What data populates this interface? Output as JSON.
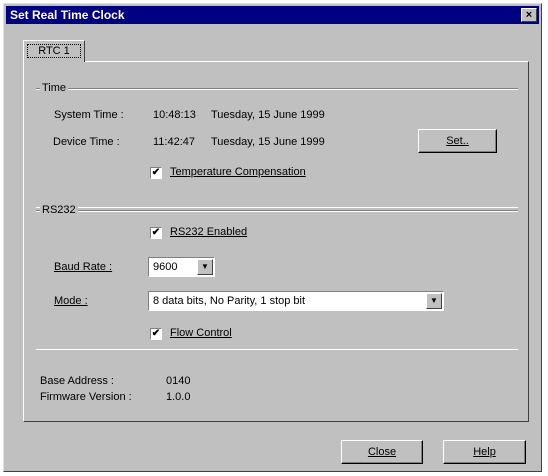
{
  "window": {
    "title": "Set Real Time Clock",
    "close_glyph": "×"
  },
  "tab": {
    "label": "RTC 1"
  },
  "time_group": {
    "legend": "Time",
    "system_time_label": "System Time :",
    "system_time_value": "10:48:13",
    "system_date_value": "Tuesday, 15 June 1999",
    "device_time_label": "Device Time :",
    "device_time_value": "11:42:47",
    "device_date_value": "Tuesday, 15 June 1999",
    "set_button": "Set..",
    "temp_comp": {
      "label": "Temperature Compensation",
      "checked": true
    }
  },
  "rs232_group": {
    "legend": "RS232",
    "enabled": {
      "label": "RS232 Enabled",
      "checked": true
    },
    "baud_rate_label": "Baud Rate :",
    "baud_rate_value": "9600",
    "mode_label": "Mode :",
    "mode_value": "8 data bits, No Parity, 1 stop bit",
    "flow_control": {
      "label": "Flow Control",
      "checked": true
    }
  },
  "info": {
    "base_address_label": "Base Address :",
    "base_address_value": "0140",
    "firmware_label": "Firmware Version :",
    "firmware_value": "1.0.0"
  },
  "footer": {
    "close_button": "Close",
    "help_button": "Help"
  },
  "icons": {
    "checkmark": "✔",
    "dropdown_arrow": "▼"
  }
}
